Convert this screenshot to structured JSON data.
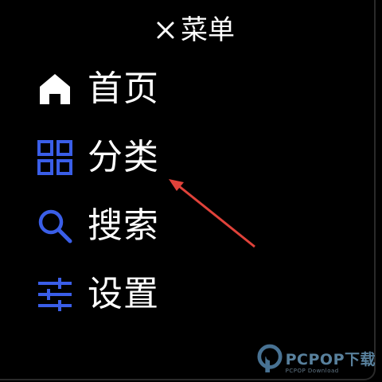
{
  "header": {
    "title": "菜单",
    "close_icon": "close-icon"
  },
  "menu": {
    "items": [
      {
        "label": "首页",
        "icon": "home-icon",
        "icon_color": "#ffffff"
      },
      {
        "label": "分类",
        "icon": "grid-icon",
        "icon_color": "#3a5ee8"
      },
      {
        "label": "搜索",
        "icon": "search-icon",
        "icon_color": "#3a5ee8"
      },
      {
        "label": "设置",
        "icon": "sliders-icon",
        "icon_color": "#3a5ee8"
      }
    ]
  },
  "annotation": {
    "arrow_color": "#e0423a",
    "arrow_target": "分类"
  },
  "watermark": {
    "main": "PCPOP下载",
    "sub": "PCPOP Download",
    "logo": "pcpop-logo-icon"
  },
  "colors": {
    "background": "#000000",
    "accent": "#3a5ee8",
    "text": "#ffffff"
  }
}
